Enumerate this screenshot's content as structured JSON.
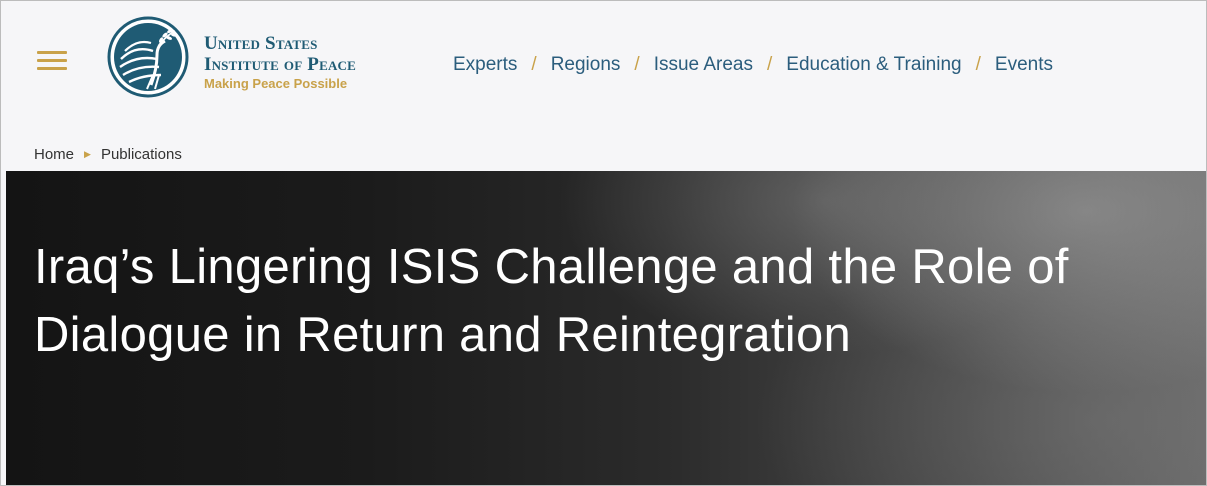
{
  "header": {
    "menu_icon": "hamburger-menu-icon",
    "logo_icon": "usip-dove-seal-icon",
    "brand": {
      "line1": "United States",
      "line2": "Institute of Peace",
      "tagline": "Making Peace Possible"
    },
    "nav": {
      "separator": "/",
      "items": [
        {
          "label": "Experts"
        },
        {
          "label": "Regions"
        },
        {
          "label": "Issue Areas"
        },
        {
          "label": "Education & Training"
        },
        {
          "label": "Events"
        }
      ]
    }
  },
  "breadcrumb": {
    "items": [
      {
        "label": "Home"
      },
      {
        "label": "Publications"
      }
    ],
    "separator_icon": "triangle-right-icon"
  },
  "hero": {
    "title": "Iraq’s Lingering ISIS Challenge and the Role of Dialogue in Return and Reintegration"
  },
  "colors": {
    "accent_gold": "#c9a24a",
    "brand_blue": "#1f5b74",
    "nav_blue": "#2b5d7d",
    "header_bg": "#f6f6f8"
  }
}
